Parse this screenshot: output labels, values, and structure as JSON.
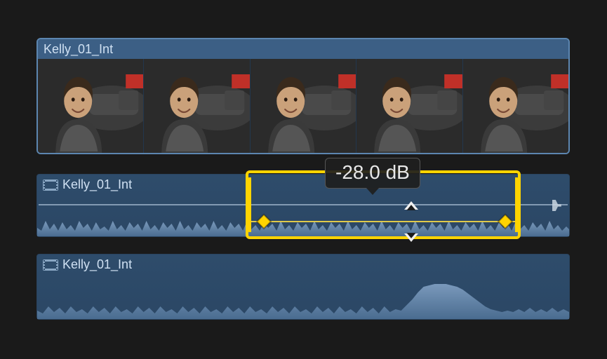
{
  "video_clip": {
    "title": "Kelly_01_Int"
  },
  "audio_clip_1": {
    "title": "Kelly_01_Int"
  },
  "audio_clip_2": {
    "title": "Kelly_01_Int"
  },
  "range_tooltip": "-28.0 dB"
}
